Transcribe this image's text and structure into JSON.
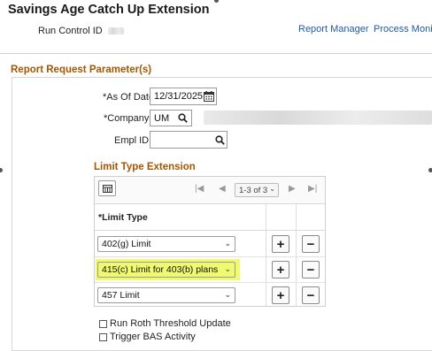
{
  "page": {
    "title": "Savings Age Catch Up Extension"
  },
  "header": {
    "run_control_label": "Run Control ID",
    "run_control_value": "",
    "report_manager": "Report Manager",
    "process_monitor": "Process Monitor"
  },
  "params": {
    "section_title": "Report Request Parameter(s)",
    "as_of_date_label": "*As Of Date",
    "as_of_date_value": "12/31/2025",
    "company_label": "*Company",
    "company_value": "UM",
    "empl_id_label": "Empl ID",
    "empl_id_value": ""
  },
  "limit_grid": {
    "title": "Limit Type Extension",
    "pager_text": "1-3 of 3",
    "column_header": "*Limit Type",
    "rows": [
      {
        "value": "402(g) Limit",
        "highlighted": false
      },
      {
        "value": "415(c) Limit for 403(b) plans",
        "highlighted": true
      },
      {
        "value": "457 Limit",
        "highlighted": false
      }
    ],
    "highlight_color": "#f0fa6e"
  },
  "options": {
    "run_roth": "Run Roth Threshold Update",
    "trigger_bas": "Trigger BAS Activity"
  }
}
